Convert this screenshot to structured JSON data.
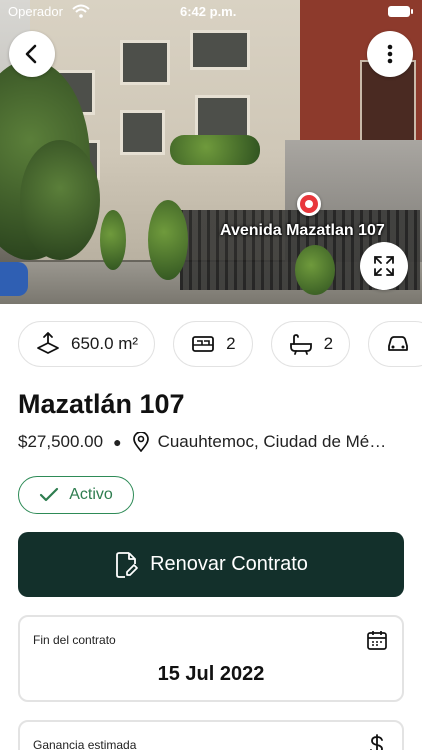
{
  "status_bar": {
    "carrier": "Operador",
    "time": "6:42 p.m."
  },
  "hero": {
    "street_label": "Avenida Mazatlan 107"
  },
  "features": [
    {
      "icon": "area-icon",
      "value": "650.0 m²"
    },
    {
      "icon": "bed-icon",
      "value": "2"
    },
    {
      "icon": "bathtub-icon",
      "value": "2"
    },
    {
      "icon": "car-icon",
      "value": ""
    }
  ],
  "property": {
    "title": "Mazatlán 107",
    "price": "$27,500.00",
    "location": "Cuauhtemoc, Ciudad de México"
  },
  "status": {
    "label": "Activo",
    "color": "#2e8b57"
  },
  "actions": {
    "renew_label": "Renovar Contrato",
    "renew_color": "#13302b"
  },
  "contract_end": {
    "label": "Fin del contrato",
    "value": "15 Jul 2022"
  },
  "estimated_gain": {
    "label": "Ganancia estimada"
  }
}
